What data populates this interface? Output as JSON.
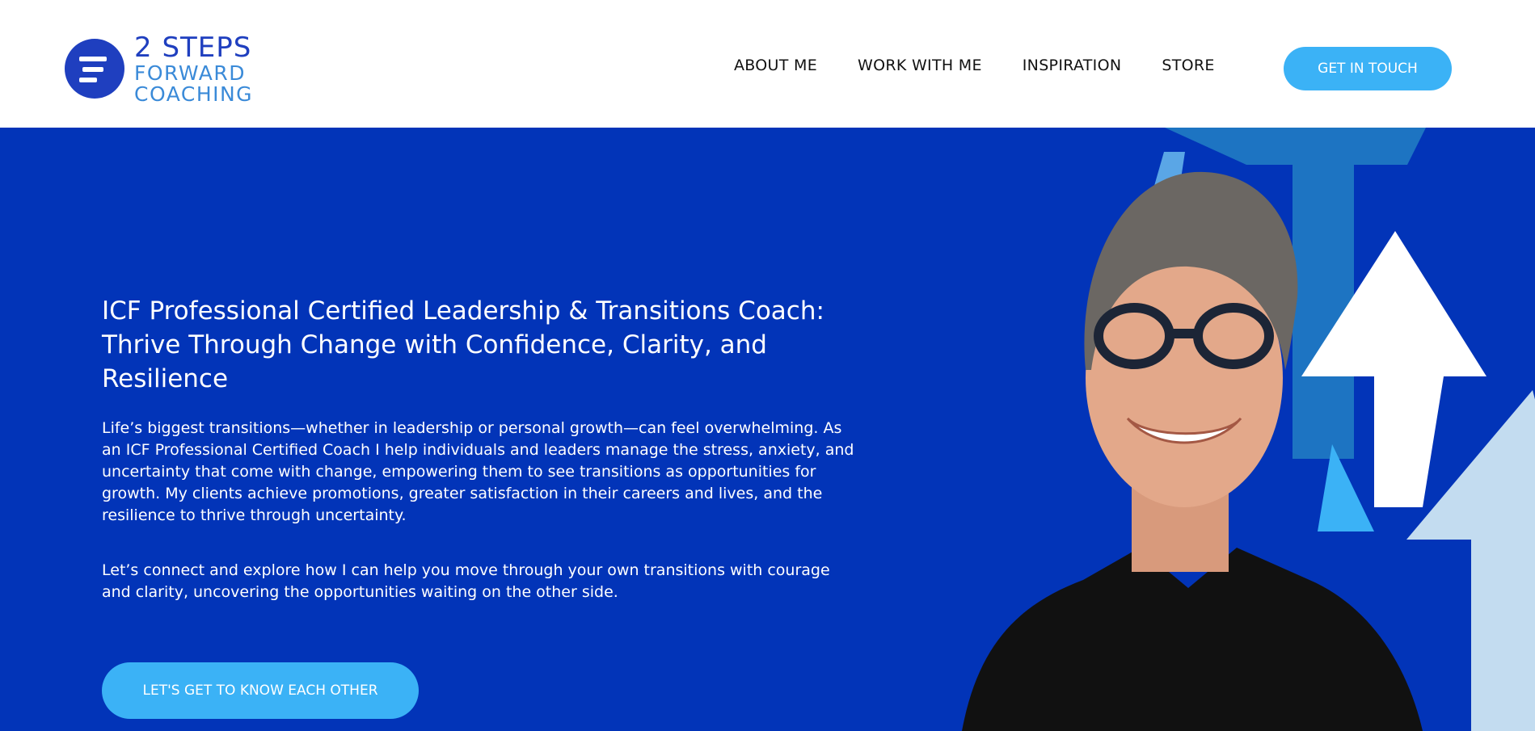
{
  "brand": {
    "line1": "2 STEPS",
    "line2": "FORWARD",
    "line3": "COACHING",
    "color_primary": "#1f3fbf",
    "color_secondary": "#3a8ad8"
  },
  "nav": {
    "items": [
      {
        "label": "ABOUT ME"
      },
      {
        "label": "WORK WITH ME"
      },
      {
        "label": "INSPIRATION"
      },
      {
        "label": "STORE"
      }
    ],
    "cta_label": "GET IN TOUCH"
  },
  "hero": {
    "title": "ICF Professional Certified Leadership & Transitions Coach: Thrive Through Change with Confidence, Clarity, and Resilience",
    "paragraph1": "Life’s biggest transitions—whether in leadership or personal growth—can feel overwhelming. As an ICF Professional Certified Coach I help individuals and leaders manage the stress, anxiety, and uncertainty that come with change, empowering them to see transitions as opportunities for growth. My clients achieve promotions, greater satisfaction in their careers and lives, and the resilience to thrive through uncertainty.",
    "paragraph2": "Let’s connect and explore how I can help you move through your own transitions with courage and clarity, uncovering the opportunities waiting on the other side.",
    "cta_label": "LET'S GET TO KNOW EACH OTHER",
    "image": "smiling-man-with-glasses-and-arrows"
  },
  "colors": {
    "hero_bg": "#0234b8",
    "accent": "#3bb2f6",
    "arrow_dark": "#1d74c2",
    "arrow_light": "#c3dcf0",
    "arrow_white": "#ffffff",
    "shirt": "#111111",
    "skin": "#e3a88a",
    "hair": "#6b6763"
  }
}
